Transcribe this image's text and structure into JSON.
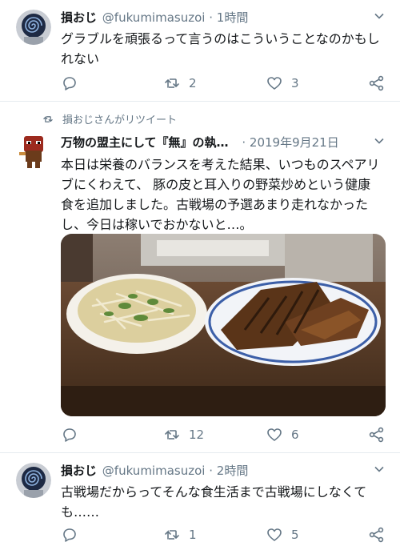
{
  "tweets": [
    {
      "name": "損おじ",
      "handle": "@fukumimasuzoi",
      "dot": "·",
      "time": "1時間",
      "text_lines": [
        "グラブルを頑張るって言うのはこういうことなのかもし",
        "れない"
      ],
      "reply_count": "",
      "retweet_count": "2",
      "like_count": "3"
    },
    {
      "retweeted_by": "損おじさんがリツイート",
      "name": "万物の盟主にして『無』の執…",
      "dot": "·",
      "time": "2019年9月21日",
      "text_lines": [
        "本日は栄養のバランスを考えた結果、いつものスペアリ",
        "ブにくわえて、 豚の皮と耳入りの野菜炒めという健康",
        "食を追加しました。古戦場の予選あまり走れなかった",
        "し、今日は稼いでおかないと…。"
      ],
      "retweet_count": "12",
      "like_count": "6"
    },
    {
      "name": "損おじ",
      "handle": "@fukumimasuzoi",
      "dot": "·",
      "time": "2時間",
      "text_lines": [
        "古戦場だからってそんな食生活まで古戦場にしなくて",
        "も……"
      ],
      "retweet_count": "1",
      "like_count": "5"
    }
  ],
  "icons": [
    "avatar-spiral",
    "chevron-down-icon",
    "reply-icon",
    "retweet-icon",
    "like-icon",
    "share-icon"
  ],
  "colors": {
    "text": "#14171a",
    "secondary": "#657786",
    "divider": "#e6ecf0"
  }
}
